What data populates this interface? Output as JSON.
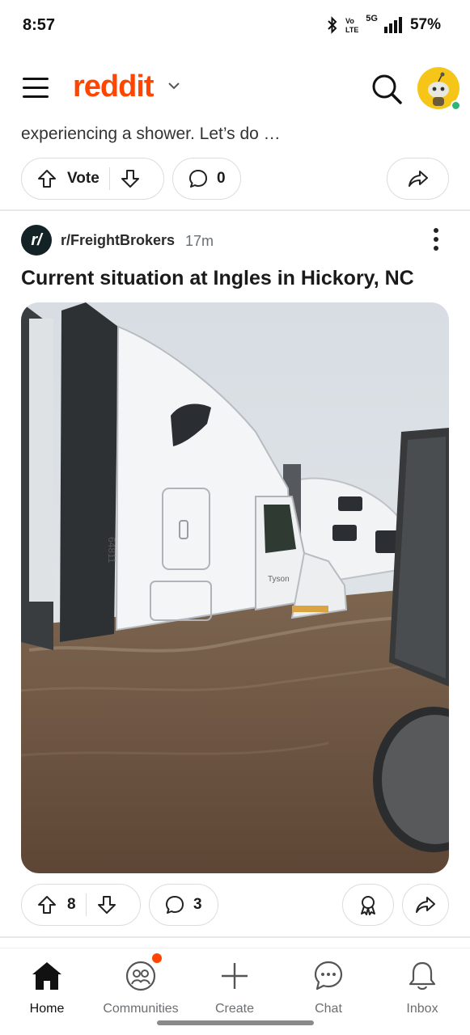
{
  "status_bar": {
    "time": "8:57",
    "network": "5G",
    "battery": "57%",
    "icons": [
      "bluetooth-icon",
      "volte-icon",
      "signal-icon"
    ]
  },
  "header": {
    "logo": "reddit",
    "icons": [
      "menu-icon",
      "chevron-down-icon",
      "search-icon",
      "avatar"
    ]
  },
  "previous_post": {
    "snippet": "experiencing a shower. Let’s do …",
    "vote_label": "Vote",
    "comment_count": "0"
  },
  "post": {
    "subreddit": "r/FreightBrokers",
    "subreddit_icon": "r/",
    "time": "17m",
    "title": "Current situation at Ingles in Hickory, NC",
    "vote_count": "8",
    "comment_count": "3",
    "image_labels": {
      "truck_number": "64811",
      "truck_brand": "Tyson"
    }
  },
  "bottom_nav": {
    "items": [
      {
        "label": "Home",
        "icon": "home-icon",
        "active": true
      },
      {
        "label": "Communities",
        "icon": "communities-icon",
        "active": false,
        "badge": true
      },
      {
        "label": "Create",
        "icon": "plus-icon",
        "active": false
      },
      {
        "label": "Chat",
        "icon": "chat-icon",
        "active": false
      },
      {
        "label": "Inbox",
        "icon": "bell-icon",
        "active": false
      }
    ]
  },
  "colors": {
    "brand": "#ff4500",
    "border": "#d9dde0",
    "online": "#2bb673"
  }
}
